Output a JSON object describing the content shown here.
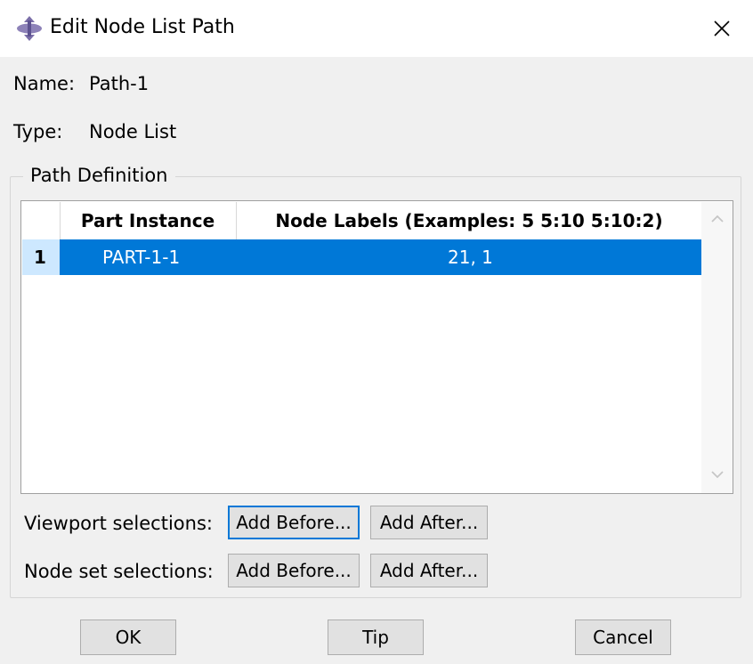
{
  "window": {
    "title": "Edit Node List Path"
  },
  "fields": {
    "name_label": "Name:",
    "name_value": "Path-1",
    "type_label": "Type:",
    "type_value": "Node List"
  },
  "group": {
    "title": "Path Definition",
    "table": {
      "columns": [
        "Part Instance",
        "Node Labels (Examples: 5 5:10 5:10:2)"
      ],
      "rows": [
        {
          "num": "1",
          "instance": "PART-1-1",
          "labels": "21, 1"
        }
      ]
    },
    "viewport": {
      "label": "Viewport selections:",
      "add_before": "Add Before...",
      "add_after": "Add After..."
    },
    "nodeset": {
      "label": "Node set selections:",
      "add_before": "Add Before...",
      "add_after": "Add After..."
    }
  },
  "footer": {
    "ok": "OK",
    "tip": "Tip",
    "cancel": "Cancel"
  },
  "colors": {
    "selection": "#0078d7",
    "row_header_selected": "#cde8ff",
    "focus_border": "#0078d7"
  },
  "icons": [
    "app-icon",
    "close-icon",
    "scroll-up-icon",
    "scroll-down-icon"
  ]
}
